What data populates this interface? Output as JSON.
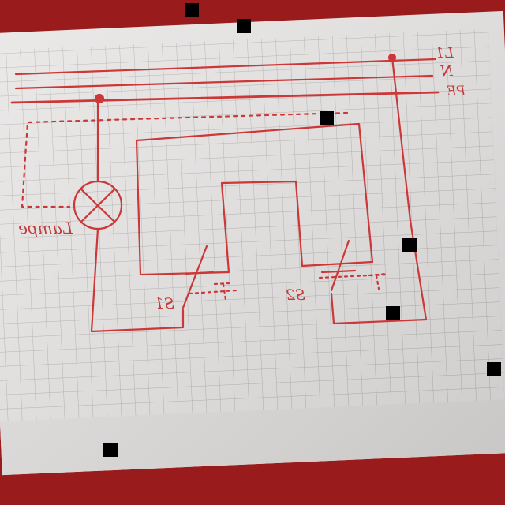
{
  "colors": {
    "table": "#9a1b1b",
    "paper": "#e9e7e6",
    "grid": "#b9b4b4",
    "ink": "#cc3737"
  },
  "diagram": {
    "terminals": {
      "l1": "L1",
      "n": "N",
      "pe": "PE"
    },
    "lamp_label": "Lampe",
    "switch_left_label": "S1",
    "switch_right_label": "S2"
  }
}
